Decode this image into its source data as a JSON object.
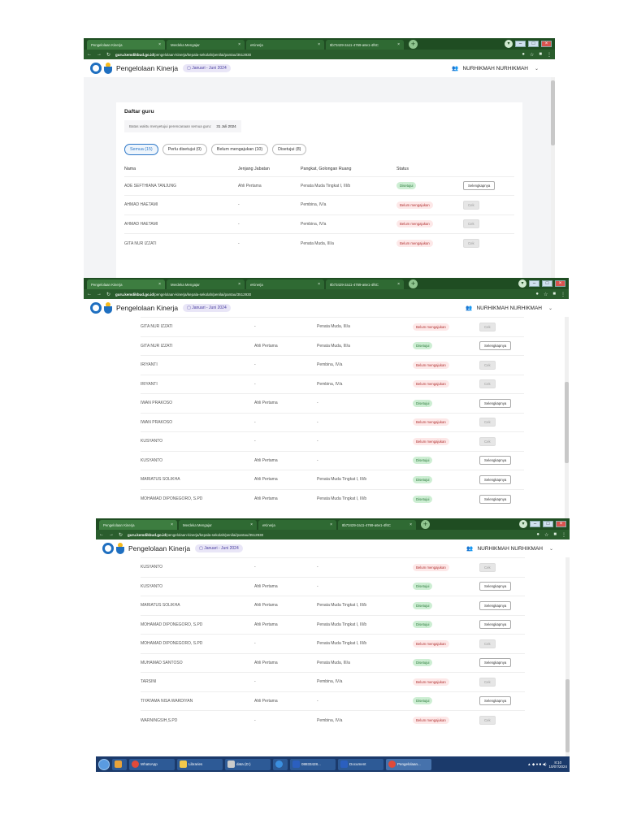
{
  "browser": {
    "tabs": [
      {
        "title": "Pengelolaan Kinerja"
      },
      {
        "title": "Merdeka Mengajar"
      },
      {
        "title": "eKinerja"
      },
      {
        "title": "8b73429-2a11-4769-a6e1-4f6C"
      }
    ],
    "url_host": "guru.kemdikbud.go.id",
    "url_path": "/pengelolaan-kinerja/kepala-sekolah/penilai/pantau/3512930"
  },
  "header": {
    "title": "Pengelolaan Kinerja",
    "period": "Januari - Juni 2024",
    "user": "NURHIKMAH NURHIKMAH"
  },
  "card": {
    "title": "Daftar guru",
    "deadline_label": "Batas waktu menyetujui perencanaan semua guru:",
    "deadline_value": "31 Juli 2024"
  },
  "filters": [
    "Semua (15)",
    "Perlu disetujui (0)",
    "Belum mengajukan (10)",
    "Disetujui (8)"
  ],
  "table": {
    "headers": [
      "Nama",
      "Jenjang Jabatan",
      "Pangkat, Golongan Ruang",
      "Status"
    ],
    "rows": [
      {
        "name": "ADE SEFTHIANA TANJUNG",
        "jenjang": "Ahli Pertama",
        "pangkat": "Penata Muda Tingkat I, III/b",
        "status": "Disetujui",
        "action": "Selengkapnya"
      },
      {
        "name": "AHMAD HAETAMI",
        "jenjang": "-",
        "pangkat": "Pembina, IV/a",
        "status": "Belum mengajukan",
        "action": "Cek"
      },
      {
        "name": "AHMAD HAETAMI",
        "jenjang": "-",
        "pangkat": "Pembina, IV/a",
        "status": "Belum mengajukan",
        "action": "Cek"
      },
      {
        "name": "GITA NUR IZZATI",
        "jenjang": "-",
        "pangkat": "Penata Muda, III/a",
        "status": "Belum mengajukan",
        "action": "Cek"
      },
      {
        "name": "GITA NUR IZZATI",
        "jenjang": "Ahli Pertama",
        "pangkat": "Penata Muda, III/a",
        "status": "Disetujui",
        "action": "Selengkapnya"
      },
      {
        "name": "IRIYANTI",
        "jenjang": "-",
        "pangkat": "Pembina, IV/a",
        "status": "Belum mengajukan",
        "action": "Cek"
      },
      {
        "name": "IRIYANTI",
        "jenjang": "-",
        "pangkat": "Pembina, IV/a",
        "status": "Belum mengajukan",
        "action": "Cek"
      },
      {
        "name": "IWAN PRAKOSO",
        "jenjang": "Ahli Pertama",
        "pangkat": "-",
        "status": "Disetujui",
        "action": "Selengkapnya"
      },
      {
        "name": "IWAN PRAKOSO",
        "jenjang": "-",
        "pangkat": "-",
        "status": "Belum mengajukan",
        "action": "Cek"
      },
      {
        "name": "KUSYANTO",
        "jenjang": "-",
        "pangkat": "-",
        "status": "Belum mengajukan",
        "action": "Cek"
      },
      {
        "name": "KUSYANTO",
        "jenjang": "Ahli Pertama",
        "pangkat": "-",
        "status": "Disetujui",
        "action": "Selengkapnya"
      },
      {
        "name": "MARIATUS SOLIKHA",
        "jenjang": "Ahli Pertama",
        "pangkat": "Penata Muda Tingkat I, III/b",
        "status": "Disetujui",
        "action": "Selengkapnya"
      },
      {
        "name": "MOHAMAD DIPONEGORO, S.PD",
        "jenjang": "Ahli Pertama",
        "pangkat": "Penata Muda Tingkat I, III/b",
        "status": "Disetujui",
        "action": "Selengkapnya"
      },
      {
        "name": "MOHAMAD DIPONEGORO, S.PD",
        "jenjang": "-",
        "pangkat": "Penata Muda Tingkat I, III/b",
        "status": "Belum mengajukan",
        "action": "Cek"
      },
      {
        "name": "MUHAMAD SANTOSO",
        "jenjang": "Ahli Pertama",
        "pangkat": "Penata Muda, III/a",
        "status": "Disetujui",
        "action": "Selengkapnya"
      },
      {
        "name": "TARSINI",
        "jenjang": "-",
        "pangkat": "Pembina, IV/a",
        "status": "Belum mengajukan",
        "action": "Cek"
      },
      {
        "name": "TIYATAMA NISA WARDIYAN",
        "jenjang": "Ahli Pertama",
        "pangkat": "-",
        "status": "Disetujui",
        "action": "Selengkapnya"
      },
      {
        "name": "WARNINGSIH,S.PD",
        "jenjang": "-",
        "pangkat": "Pembina, IV/a",
        "status": "Belum mengajukan",
        "action": "Cek"
      }
    ]
  },
  "taskbar": {
    "items": [
      "WhatsApp",
      "Libraries",
      "data (D:)",
      "08833428...",
      "Document",
      "Pengelolaan..."
    ],
    "time": "8:10",
    "date": "10/07/2024"
  }
}
